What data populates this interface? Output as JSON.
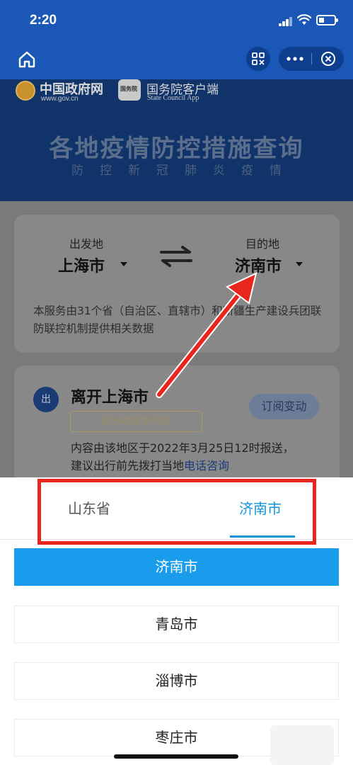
{
  "status_bar": {
    "time": "2:20"
  },
  "nav_bar": {
    "home_icon": "home-icon",
    "scan_icon": "scan-icon",
    "more_icon": "more-icon",
    "close_icon": "close-icon"
  },
  "banner": {
    "gov_site_name": "中国政府网",
    "gov_site_url": "www.gov.cn",
    "app_icon_text": "国务院",
    "app_name": "国务院客户端",
    "app_name_en": "State Council App",
    "title": "各地疫情防控措施查询",
    "subtitle": "防控新冠肺炎疫情"
  },
  "route": {
    "from_label": "出发地",
    "from_city": "上海市",
    "to_label": "目的地",
    "to_city": "济南市",
    "swap_icon": "swap-arrows-icon",
    "note": "本服务由31个省（自治区、直辖市）和新疆生产建设兵团联防联控机制提供相关数据"
  },
  "leave": {
    "badge": "出",
    "title": "离开上海市",
    "risk_tag": "部分地区中风险",
    "subscribe": "订阅变动",
    "report": "内容由该地区于2022年3月25日12时报送，",
    "report_prefix": "建议出行前先拨打当地",
    "report_link": "电话咨询"
  },
  "picker": {
    "tabs": [
      {
        "label": "山东省",
        "active": false
      },
      {
        "label": "济南市",
        "active": true
      }
    ],
    "options": [
      {
        "label": "济南市",
        "selected": true
      },
      {
        "label": "青岛市",
        "selected": false
      },
      {
        "label": "淄博市",
        "selected": false
      },
      {
        "label": "枣庄市",
        "selected": false
      }
    ]
  },
  "colors": {
    "brand_blue": "#1a57b7",
    "accent_blue": "#1296db",
    "selected_blue": "#1a9cec",
    "annotation_red": "#e8261d"
  }
}
